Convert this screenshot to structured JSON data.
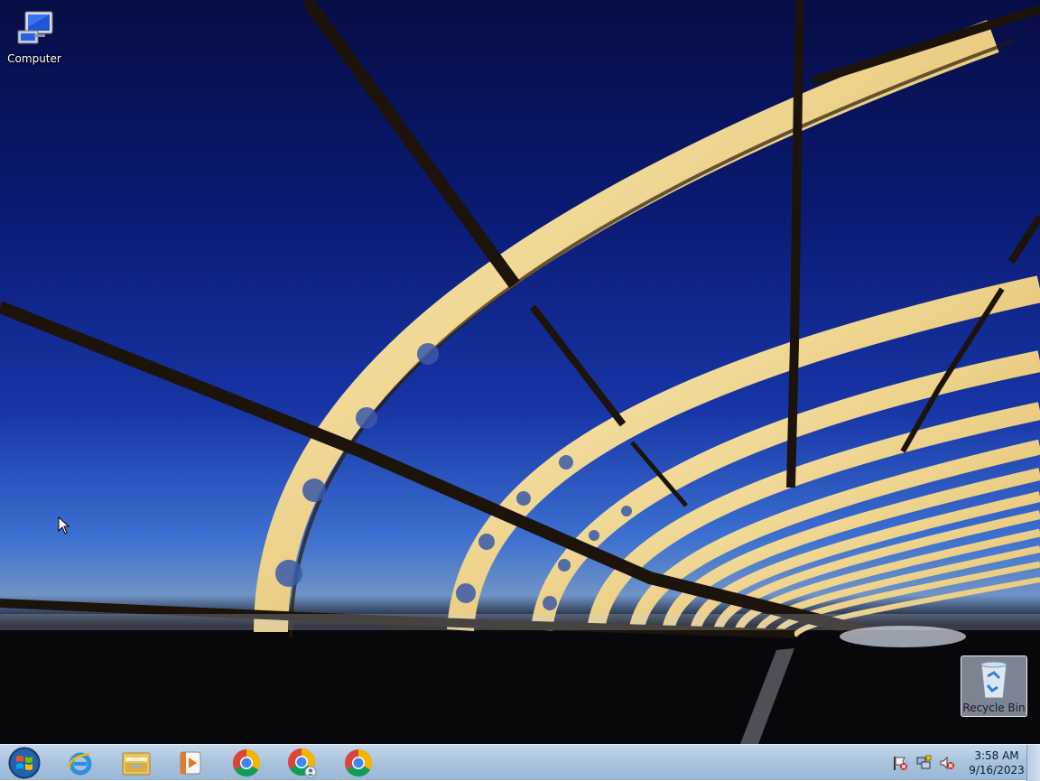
{
  "desktop": {
    "icons": [
      {
        "label": "Computer",
        "icon": "computer-icon"
      },
      {
        "label": "Recycle Bin",
        "icon": "recycle-bin-icon"
      }
    ]
  },
  "taskbar": {
    "start": {
      "icon": "windows-logo-icon"
    },
    "pinned": [
      {
        "icon": "internet-explorer-icon"
      },
      {
        "icon": "file-explorer-icon"
      },
      {
        "icon": "media-player-icon"
      },
      {
        "icon": "chrome-icon"
      },
      {
        "icon": "chrome-profile-icon"
      },
      {
        "icon": "chrome-icon"
      }
    ],
    "tray": {
      "icons": [
        "action-center-flag-icon",
        "network-icon",
        "volume-muted-icon"
      ],
      "time": "3:58 AM",
      "date": "9/16/2023"
    }
  },
  "colors": {
    "sky_top": "#070d45",
    "sky_bottom": "#3b6fd0",
    "bridge_light": "#f4e6a8",
    "taskbar": "#b4cae2"
  }
}
